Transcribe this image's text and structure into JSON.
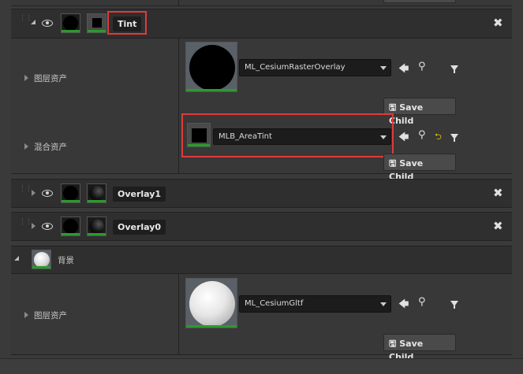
{
  "layers": {
    "tint": {
      "name": "Tint",
      "layer_asset_label": "图层资产",
      "layer_asset_value": "ML_CesiumRasterOverlay",
      "blend_asset_label": "混合资产",
      "blend_asset_value": "MLB_AreaTint",
      "save_child_1": "Save Child",
      "save_child_2": "Save Child"
    },
    "overlay1": {
      "name": "Overlay1"
    },
    "overlay0": {
      "name": "Overlay0"
    },
    "background": {
      "name": "背景",
      "layer_asset_label": "图层资产",
      "layer_asset_value": "ML_CesiumGltf",
      "save_child": "Save Child"
    }
  },
  "icons": {
    "visibility": "eye-icon",
    "close": "close-icon",
    "use_selected": "arrow-left-icon",
    "browse": "search-icon",
    "filter": "filter-icon",
    "reset": "reset-arrow-icon",
    "save": "save-icon"
  },
  "colors": {
    "highlight": "#e03a3a",
    "thumb_green": "#2b9b2b"
  }
}
